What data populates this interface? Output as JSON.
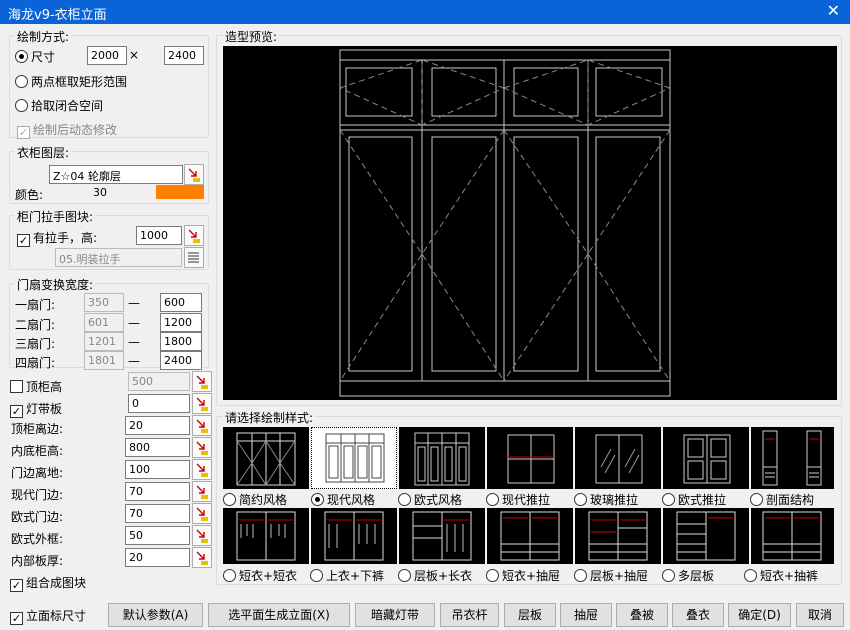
{
  "window": {
    "title": "海龙v9-衣柜立面",
    "close": "✕"
  },
  "draw_mode": {
    "label": "绘制方式:",
    "size_label": "尺寸",
    "width": "2000",
    "times": "×",
    "height": "2400",
    "opt2": "两点框取矩形范围",
    "opt3": "拾取闭合空间",
    "dynamic": "绘制后动态修改",
    "check": "✓"
  },
  "layer": {
    "label": "衣柜图层:",
    "value": "Z☆04 轮廓层",
    "color_label": "颜色:",
    "color_value": "30",
    "color_hex": "#ff7f00"
  },
  "handle": {
    "label": "柜门拉手图块:",
    "check_label": "有拉手，高:",
    "height": "1000",
    "block": "05.明装拉手"
  },
  "door_width": {
    "label": "门扇变换宽度:",
    "dash": "—",
    "rows": [
      {
        "label": "一扇门:",
        "min": "350",
        "max": "600"
      },
      {
        "label": "二扇门:",
        "min": "601",
        "max": "1200"
      },
      {
        "label": "三扇门:",
        "min": "1201",
        "max": "1800"
      },
      {
        "label": "四扇门:",
        "min": "1801",
        "max": "2400"
      }
    ]
  },
  "params": {
    "top_cabinet": {
      "label": "顶柜高",
      "value": "500"
    },
    "light_strip": {
      "label": "灯带板",
      "value": "0"
    },
    "rows": [
      {
        "label": "顶柜离边:",
        "value": "20"
      },
      {
        "label": "内底柜高:",
        "value": "800"
      },
      {
        "label": "门边离地:",
        "value": "100"
      },
      {
        "label": "现代门边:",
        "value": "70"
      },
      {
        "label": "欧式门边:",
        "value": "70"
      },
      {
        "label": "欧式外框:",
        "value": "50"
      },
      {
        "label": "内部板厚:",
        "value": "20"
      }
    ],
    "combine": "组合成图块",
    "elev_dim": "立面标尺寸"
  },
  "preview": {
    "label": "造型预览:"
  },
  "styles": {
    "label": "请选择绘制样式:",
    "row1": [
      "简约风格",
      "现代风格",
      "欧式风格",
      "现代推拉",
      "玻璃推拉",
      "欧式推拉",
      "剖面结构"
    ],
    "row2": [
      "短衣+短衣",
      "上衣+下裤",
      "层板+长衣",
      "短衣+抽屉",
      "层板+抽屉",
      "多层板",
      "短衣+抽裤"
    ],
    "selected": "现代风格"
  },
  "buttons": [
    "默认参数(A)",
    "选平面生成立面(X)",
    "暗藏灯带",
    "吊衣杆",
    "层板",
    "抽屉",
    "叠被",
    "叠衣",
    "确定(D)",
    "取消"
  ]
}
